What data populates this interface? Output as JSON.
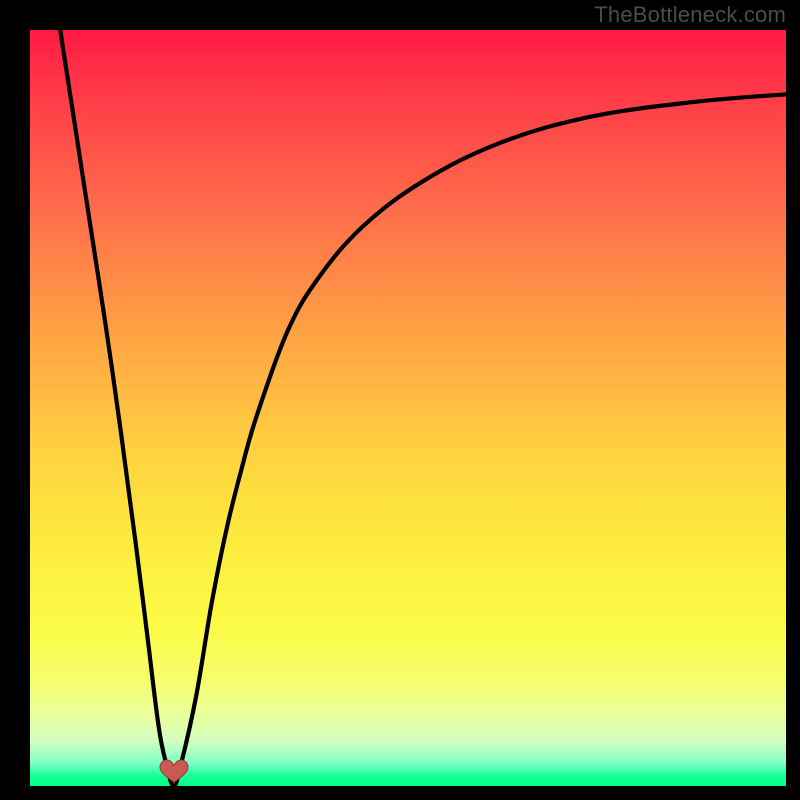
{
  "attribution": "TheBottleneck.com",
  "chart_data": {
    "type": "line",
    "title": "",
    "xlabel": "",
    "ylabel": "",
    "xlim": [
      0,
      100
    ],
    "ylim": [
      0,
      100
    ],
    "grid": false,
    "series": [
      {
        "name": "bottleneck-curve",
        "x": [
          4,
          6,
          8,
          10,
          12,
          14,
          15.5,
          17,
          18,
          19,
          20,
          22,
          24,
          26,
          28,
          30,
          34,
          38,
          44,
          52,
          62,
          74,
          88,
          100
        ],
        "values": [
          100,
          87,
          74,
          61,
          47,
          32,
          20,
          8,
          3,
          0,
          3,
          12,
          24,
          34,
          42,
          49,
          60,
          67,
          74,
          80,
          85,
          88.5,
          90.5,
          91.5
        ]
      }
    ],
    "marker": {
      "name": "heart-marker",
      "x": 19,
      "y": 1,
      "color": "#c85a53"
    },
    "background_gradient": {
      "top": "#ff1841",
      "upper_mid": "#ffa244",
      "mid": "#fdec3e",
      "lower": "#18ff99"
    }
  }
}
